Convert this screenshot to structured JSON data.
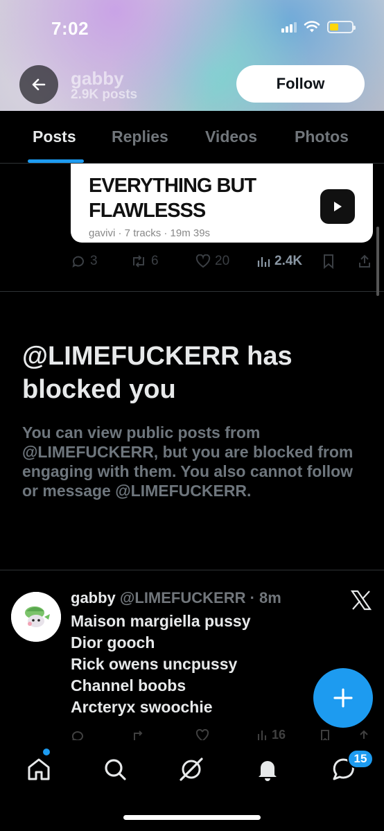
{
  "status_bar": {
    "time": "7:02"
  },
  "profile_header": {
    "name": "gabby",
    "post_count": "2.9K posts",
    "follow_label": "Follow"
  },
  "tabs": [
    {
      "label": "Posts",
      "active": true
    },
    {
      "label": "Replies",
      "active": false
    },
    {
      "label": "Videos",
      "active": false
    },
    {
      "label": "Photos",
      "active": false
    }
  ],
  "card": {
    "title_line1": "EVERYTHING BUT",
    "title_line2": "FLAWLESSS",
    "meta": "gavivi · 7 tracks · 19m 39s"
  },
  "post_actions": {
    "replies": "3",
    "reposts": "6",
    "likes": "20",
    "views": "2.4K"
  },
  "blocked": {
    "title": "@LIMEFUCKERR has blocked you",
    "description": "You can view public posts from @LIMEFUCKERR, but you are blocked from engaging with them. You also cannot follow or message @LIMEFUCKERR."
  },
  "tweet": {
    "display_name": "gabby",
    "handle": "@LIMEFUCKERR",
    "time": "· 8m",
    "lines": [
      "Maison margiella pussy",
      "Dior gooch",
      "Rick owens uncpussy",
      "Channel boobs",
      "Arcteryx swoochie"
    ],
    "views": "16"
  },
  "bottom_nav": {
    "messages_badge": "15"
  },
  "colors": {
    "accent": "#1d9bf0",
    "background": "#000000",
    "muted_text": "#71767b"
  }
}
